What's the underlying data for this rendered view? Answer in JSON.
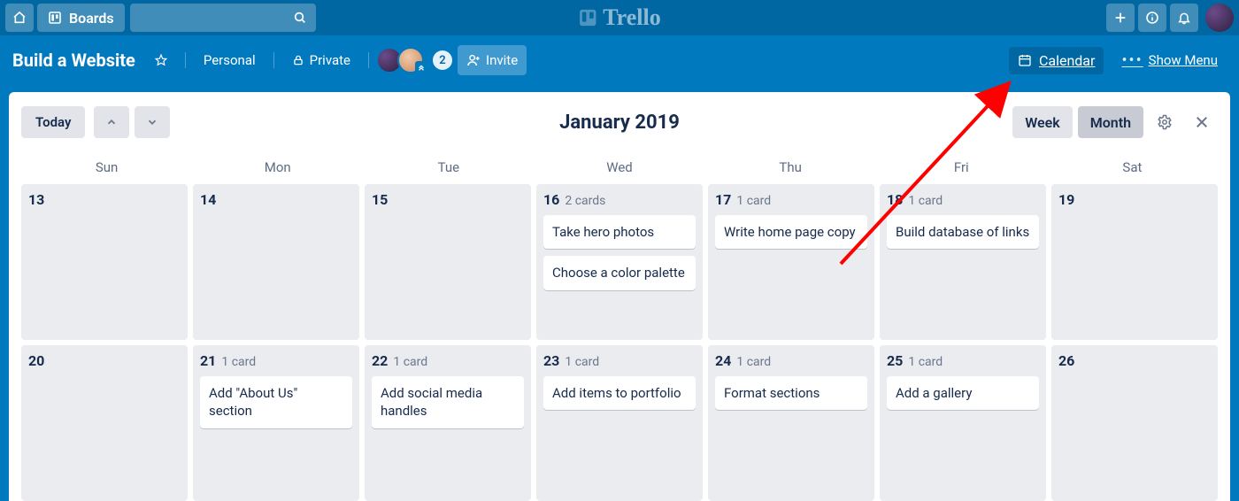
{
  "topbar": {
    "boards_label": "Boards",
    "logo_text": "Trello"
  },
  "board": {
    "title": "Build a Website",
    "visibility_team": "Personal",
    "visibility_privacy": "Private",
    "member_count": "2",
    "invite_label": "Invite",
    "calendar_label": "Calendar",
    "show_menu_label": "Show Menu"
  },
  "calendar": {
    "today_label": "Today",
    "month_title": "January 2019",
    "view_week": "Week",
    "view_month": "Month",
    "days_of_week": [
      "Sun",
      "Mon",
      "Tue",
      "Wed",
      "Thu",
      "Fri",
      "Sat"
    ],
    "cells": [
      {
        "num": "13",
        "count": "",
        "cards": []
      },
      {
        "num": "14",
        "count": "",
        "cards": []
      },
      {
        "num": "15",
        "count": "",
        "cards": []
      },
      {
        "num": "16",
        "count": "2 cards",
        "cards": [
          "Take hero photos",
          "Choose a color palette"
        ]
      },
      {
        "num": "17",
        "count": "1 card",
        "cards": [
          "Write home page copy"
        ]
      },
      {
        "num": "18",
        "count": "1 card",
        "cards": [
          "Build database of links"
        ]
      },
      {
        "num": "19",
        "count": "",
        "cards": []
      },
      {
        "num": "20",
        "count": "",
        "cards": []
      },
      {
        "num": "21",
        "count": "1 card",
        "cards": [
          "Add \"About Us\" section"
        ]
      },
      {
        "num": "22",
        "count": "1 card",
        "cards": [
          "Add social media handles"
        ]
      },
      {
        "num": "23",
        "count": "1 card",
        "cards": [
          "Add items to portfolio"
        ]
      },
      {
        "num": "24",
        "count": "1 card",
        "cards": [
          "Format sections"
        ]
      },
      {
        "num": "25",
        "count": "1 card",
        "cards": [
          "Add a gallery"
        ]
      },
      {
        "num": "26",
        "count": "",
        "cards": []
      }
    ]
  }
}
